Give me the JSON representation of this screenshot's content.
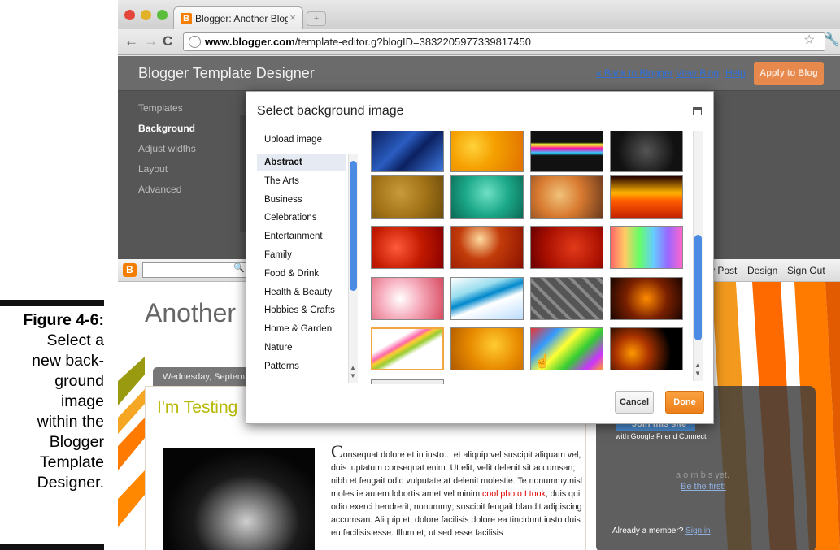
{
  "caption": {
    "figure": "Figure 4-6:",
    "text": "Select a\nnew back-\nground\nimage\nwithin the\nBlogger\nTemplate\nDesigner."
  },
  "browser": {
    "tab_title": "Blogger: Another Blogging fo",
    "tab_close": "×",
    "url_host": "www.blogger.com",
    "url_path": "/template-editor.g?blogID=3832205977339817450"
  },
  "designer": {
    "title": "Blogger Template Designer",
    "links": [
      "« Back to Blogger",
      "View Blog",
      "Help"
    ],
    "apply_label": "Apply to Blog",
    "sidebar": [
      {
        "label": "Templates",
        "active": false
      },
      {
        "label": "Background",
        "active": true
      },
      {
        "label": "Adjust widths",
        "active": false
      },
      {
        "label": "Layout",
        "active": false
      },
      {
        "label": "Advanced",
        "active": false
      }
    ]
  },
  "modal": {
    "title": "Select background image",
    "categories": [
      {
        "label": "Upload image",
        "selected": false
      },
      {
        "label": "Abstract",
        "selected": true
      },
      {
        "label": "The Arts",
        "selected": false
      },
      {
        "label": "Business",
        "selected": false
      },
      {
        "label": "Celebrations",
        "selected": false
      },
      {
        "label": "Entertainment",
        "selected": false
      },
      {
        "label": "Family",
        "selected": false
      },
      {
        "label": "Food & Drink",
        "selected": false
      },
      {
        "label": "Health & Beauty",
        "selected": false
      },
      {
        "label": "Hobbies & Crafts",
        "selected": false
      },
      {
        "label": "Home & Garden",
        "selected": false
      },
      {
        "label": "Nature",
        "selected": false
      },
      {
        "label": "Patterns",
        "selected": false
      }
    ],
    "thumbnails": [
      {
        "bg": "linear-gradient(135deg,#0a1e5c,#2a5cc0 40%,#0b2160 60%,#3d78e0)",
        "selected": false
      },
      {
        "bg": "radial-gradient(circle at 30% 40%,#ffd23a,#f5a000 40%,#e07000)",
        "selected": false
      },
      {
        "bg": "linear-gradient(180deg,#111 0%,#111 30%,#ff3 35%,#f0a 45%,#3cf 55%,#111 62%,#111 100%)",
        "selected": false
      },
      {
        "bg": "radial-gradient(circle at 50% 50%,#555,#111 70%)",
        "selected": false
      },
      {
        "bg": "radial-gradient(circle at 40% 40%,#c99a3a,#a37418 50%,#6d4c0c)",
        "selected": false
      },
      {
        "bg": "radial-gradient(circle at 50% 40%,#6fe0c4,#1ca98a 50%,#0a6a55)",
        "selected": false
      },
      {
        "bg": "radial-gradient(circle at 40% 45%,#f1c27a,#d87a30 45%,#6b3b1d)",
        "selected": false
      },
      {
        "bg": "linear-gradient(0deg,#c42100,#ff5a00 40%,#ffb400 60%,#200 100%)",
        "selected": false
      },
      {
        "bg": "radial-gradient(circle at 35% 50%,#ff5a3a,#c21a00 50%,#800)",
        "selected": false
      },
      {
        "bg": "radial-gradient(circle at 40% 30%,#ffdca0,#c23c0a 40%,#8a1000)",
        "selected": false
      },
      {
        "bg": "radial-gradient(circle at 60% 50%,#e23a1a,#a80f00 60%,#6a0000)",
        "selected": false
      },
      {
        "bg": "linear-gradient(90deg,#f66,#fc6,#6f6,#6cf,#96f,#f6c)",
        "selected": false
      },
      {
        "bg": "radial-gradient(circle at 40% 50%,#fff,#f7b0c0 40%,#d84a60)",
        "selected": false
      },
      {
        "bg": "linear-gradient(160deg,#fff 0%,#9de 30%,#08c 45%,#fff 60%,#bdf 100%)",
        "selected": false
      },
      {
        "bg": "repeating-linear-gradient(45deg,#555,#555 8px,#888 8px,#888 12px)",
        "selected": false
      },
      {
        "bg": "radial-gradient(circle at 50% 50%,#ff8a00,#7a2000 50%,#1a0500)",
        "selected": false
      },
      {
        "bg": "linear-gradient(150deg,#fff 0%,#fff 30%,#f6a 40%,#fc3 45%,#9c3 52%,#fff 60%,#fff 100%)",
        "selected": true
      },
      {
        "bg": "radial-gradient(circle at 60% 40%,#ffcc30,#e88a00 50%,#b05a00)",
        "selected": false
      },
      {
        "bg": "linear-gradient(135deg,#e33 0%,#39f 25%,#ff3 45%,#3c3 65%,#c3f 85%,#f93 100%)",
        "selected": false
      },
      {
        "bg": "radial-gradient(circle at 30% 60%,#f90,#a30 30%,#000 70%)",
        "selected": false
      }
    ],
    "cancel_label": "Cancel",
    "done_label": "Done"
  },
  "blog": {
    "title": "Another",
    "date_tab": "Wednesday, Septem",
    "post_title": "I'm Testing",
    "nav_links": [
      "y Post",
      "Design",
      "Sign Out"
    ],
    "post_body_start": "C",
    "post_body_1": "onsequat dolore et in iusto... et aliquip vel suscipit aliquam vel, duis luptatum consequat enim. Ut elit, velit delenit sit accumsan; nibh et feugait odio vulputate at delenit molestie. Te nonummy nisl molestie autem lobortis amet vel minim ",
    "post_link": "cool photo I took",
    "post_body_2": ", duis qui odio exerci hendrerit, nonummy; suscipit feugait blandit adipiscing accumsan. Aliquip et; dolore facilisis dolore ea tincidunt iusto duis eu facilisis esse. Illum et; ut sed esse facilisis",
    "gadget_join": "Join this site",
    "gadget_sub": "with Google Friend Connect",
    "gadget_faint": "a    o  m    b  s yet.",
    "gadget_first": "Be the first!",
    "gadget_already": "Already a member?",
    "gadget_signin": "Sign in"
  }
}
